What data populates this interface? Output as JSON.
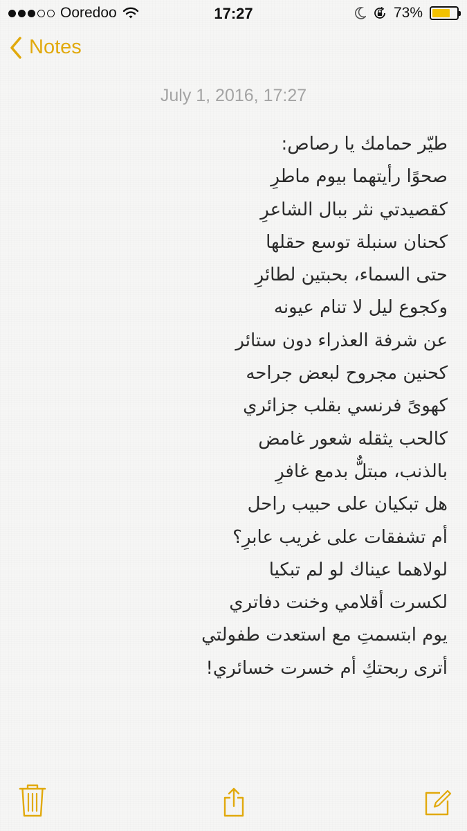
{
  "status_bar": {
    "carrier": "Ooredoo",
    "time": "17:27",
    "battery_percent": "73%",
    "battery_level": 0.73,
    "signal_bars_filled": 3,
    "signal_bars_total": 5
  },
  "nav": {
    "back_label": "Notes"
  },
  "note": {
    "date": "July 1, 2016, 17:27",
    "lines": [
      "طيّر حمامك يا رصاص:",
      "صحوًا رأيتهما بيوم ماطرِ",
      "كقصيدتي نثر ببال الشاعرِ",
      "كحنان سنبلة توسع حقلها",
      "حتى السماء، بحبتين لطائرِ",
      "وكجوع ليل لا تنام عيونه",
      "عن شرفة العذراء دون ستائر",
      "كحنين مجروح لبعض جراحه",
      "كهوىً فرنسي بقلب جزائري",
      "كالحب يثقله شعور غامض",
      "بالذنب، مبتلٌّ بدمع غافرِ",
      "هل تبكيان على حبيب راحل",
      "أم تشفقات على غريب عابرِ؟",
      "لولاهما عيناك لو لم تبكيا",
      "لكسرت أقلامي وخنت دفاتري",
      "يوم ابتسمتِ مع استعدت طفولتي",
      "أترى ربحتكِ أم خسرت خسائري!"
    ]
  },
  "colors": {
    "accent": "#e1a90c",
    "date_gray": "#a4a4a4",
    "text": "#2a2a2a"
  },
  "icons": {
    "wifi": "wifi-icon",
    "moon": "moon-icon",
    "rotation_lock": "rotation-lock-icon",
    "battery": "battery-icon",
    "back": "chevron-left-icon",
    "trash": "trash-icon",
    "share": "share-icon",
    "compose": "compose-icon"
  }
}
